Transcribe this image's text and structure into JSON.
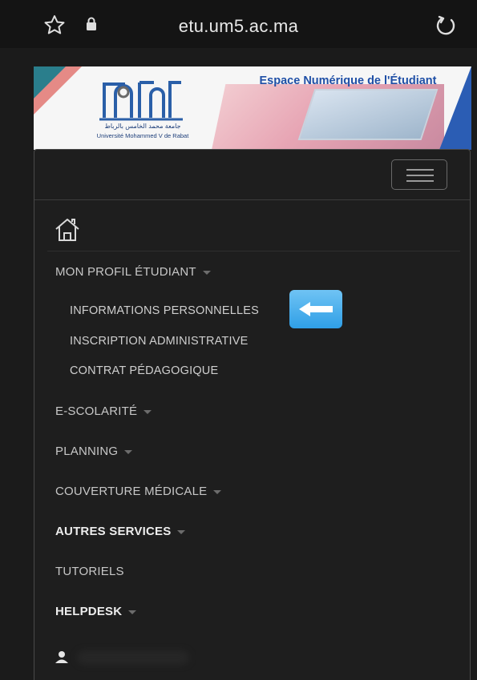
{
  "browser": {
    "url": "etu.um5.ac.ma",
    "icons": [
      "star-icon",
      "lock-icon",
      "reload-icon"
    ]
  },
  "banner": {
    "title": "Espace Numérique de l'Étudiant",
    "university_ar": "جامعة محمد الخامس بالرباط",
    "university_fr": "Université Mohammed V de Rabat"
  },
  "nav": {
    "home_icon": "home-icon",
    "menu_icon": "hamburger-icon",
    "profile": "MON PROFIL ÉTUDIANT",
    "sub_items": [
      "INFORMATIONS PERSONNELLES",
      "INSCRIPTION ADMINISTRATIVE",
      "CONTRAT PÉDAGOGIQUE"
    ],
    "items": [
      {
        "label": "E-SCOLARITÉ"
      },
      {
        "label": "PLANNING"
      },
      {
        "label": "COUVERTURE MÉDICALE"
      },
      {
        "label": "AUTRES SERVICES"
      },
      {
        "label": "TUTORIELS"
      },
      {
        "label": "HELPDESK"
      }
    ],
    "user_icon": "user-icon"
  },
  "colors": {
    "background": "#1b1b1b",
    "banner_title": "#1f4fa6",
    "arrow_button": "#2f9fe6"
  }
}
